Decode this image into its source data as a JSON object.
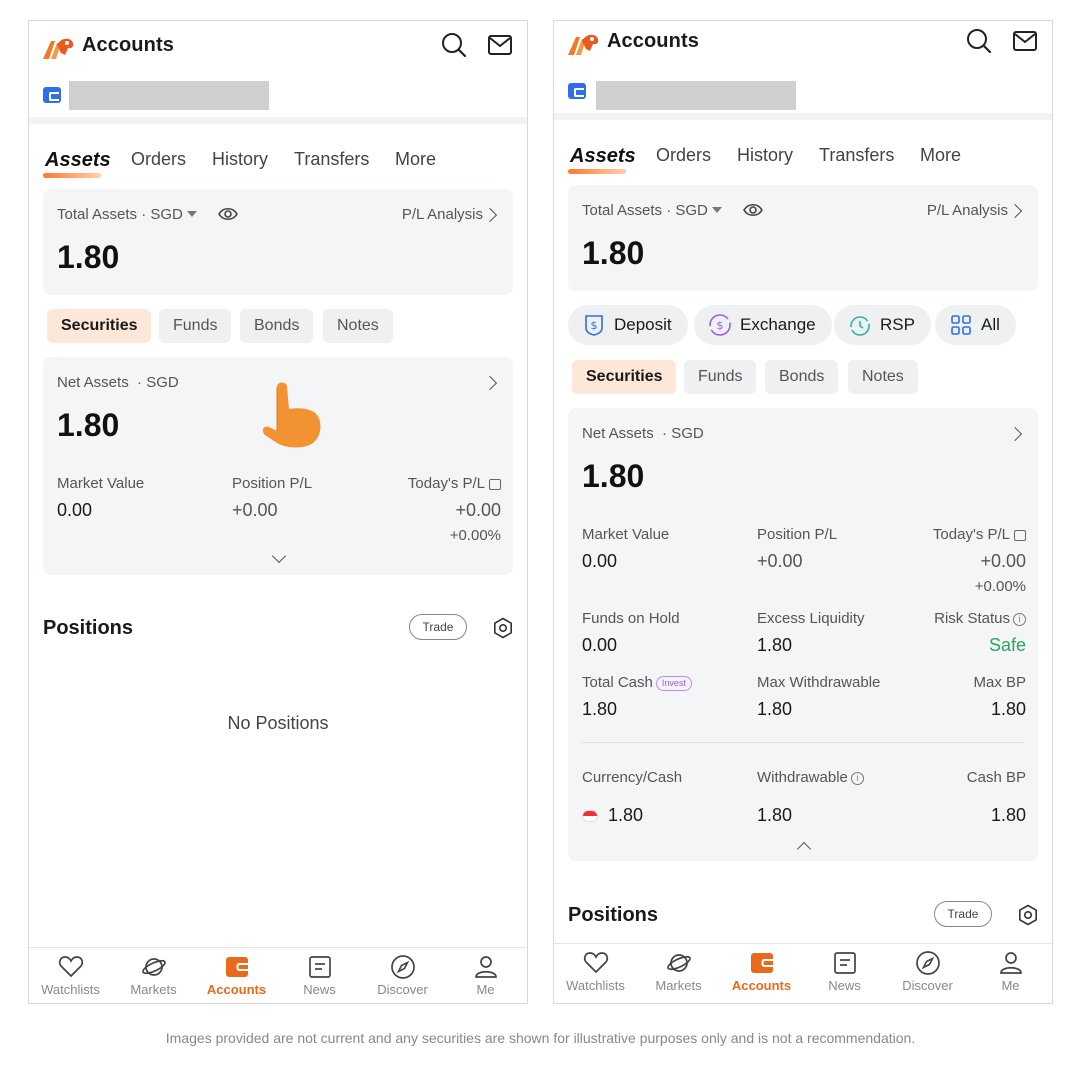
{
  "left": {
    "header": {
      "title": "Accounts"
    },
    "tabs": [
      "Assets",
      "Orders",
      "History",
      "Transfers",
      "More"
    ],
    "total_assets": {
      "label": "Total Assets",
      "currency": "· SGD",
      "pl_link": "P/L Analysis",
      "value": "1.80"
    },
    "asset_types": [
      "Securities",
      "Funds",
      "Bonds",
      "Notes"
    ],
    "net_assets": {
      "label": "Net Assets",
      "currency": "· SGD",
      "value": "1.80",
      "market_value_label": "Market Value",
      "market_value": "0.00",
      "position_pl_label": "Position P/L",
      "position_pl": "+0.00",
      "todays_pl_label": "Today's P/L",
      "todays_pl": "+0.00",
      "todays_pl_pct": "+0.00%"
    },
    "positions": {
      "title": "Positions",
      "trade_label": "Trade",
      "empty_text": "No Positions"
    }
  },
  "right": {
    "header": {
      "title": "Accounts"
    },
    "tabs": [
      "Assets",
      "Orders",
      "History",
      "Transfers",
      "More"
    ],
    "total_assets": {
      "label": "Total Assets",
      "currency": "· SGD",
      "pl_link": "P/L Analysis",
      "value": "1.80"
    },
    "actions": [
      "Deposit",
      "Exchange",
      "RSP",
      "All"
    ],
    "asset_types": [
      "Securities",
      "Funds",
      "Bonds",
      "Notes"
    ],
    "net_assets": {
      "label": "Net Assets",
      "currency": "· SGD",
      "value": "1.80",
      "market_value_label": "Market Value",
      "market_value": "0.00",
      "position_pl_label": "Position P/L",
      "position_pl": "+0.00",
      "todays_pl_label": "Today's P/L",
      "todays_pl": "+0.00",
      "todays_pl_pct": "+0.00%",
      "funds_on_hold_label": "Funds on Hold",
      "funds_on_hold": "0.00",
      "excess_liquidity_label": "Excess Liquidity",
      "excess_liquidity": "1.80",
      "risk_status_label": "Risk Status",
      "risk_status": "Safe",
      "total_cash_label": "Total Cash",
      "invest_badge": "Invest",
      "total_cash": "1.80",
      "max_withdrawable_label": "Max Withdrawable",
      "max_withdrawable": "1.80",
      "max_bp_label": "Max BP",
      "max_bp": "1.80",
      "currency_cash_label": "Currency/Cash",
      "currency_cash": "1.80",
      "withdrawable_label": "Withdrawable",
      "withdrawable": "1.80",
      "cash_bp_label": "Cash BP",
      "cash_bp": "1.80"
    },
    "positions": {
      "title": "Positions",
      "trade_label": "Trade"
    }
  },
  "nav": [
    "Watchlists",
    "Markets",
    "Accounts",
    "News",
    "Discover",
    "Me"
  ],
  "footer": "Images provided are not current and any securities are shown for illustrative purposes only and is not a recommendation.",
  "colors": {
    "accent": "#e86a1c",
    "safe": "#2aa65d",
    "card": "#f4f5f7",
    "account_icon": "#2f6fe8"
  }
}
